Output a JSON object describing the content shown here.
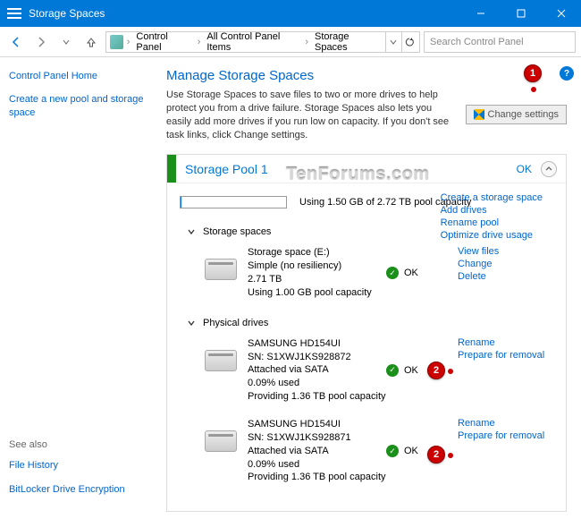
{
  "window": {
    "title": "Storage Spaces"
  },
  "breadcrumb": {
    "items": [
      "Control Panel",
      "All Control Panel Items",
      "Storage Spaces"
    ]
  },
  "search": {
    "placeholder": "Search Control Panel"
  },
  "sidebar": {
    "home": "Control Panel Home",
    "create_pool": "Create a new pool and storage space",
    "see_also_label": "See also",
    "file_history": "File History",
    "bitlocker": "BitLocker Drive Encryption"
  },
  "page": {
    "title": "Manage Storage Spaces",
    "desc": "Use Storage Spaces to save files to two or more drives to help protect you from a drive failure. Storage Spaces also lets you easily add more drives if you run low on capacity. If you don't see task links, click Change settings.",
    "change_settings": "Change settings"
  },
  "pool": {
    "name": "Storage Pool 1",
    "status": "OK",
    "usage_text": "Using 1.50 GB of 2.72 TB pool capacity",
    "progress_pct": 1,
    "links": {
      "create_space": "Create a storage space",
      "add_drives": "Add drives",
      "rename_pool": "Rename pool",
      "optimize": "Optimize drive usage"
    },
    "sections": {
      "spaces_label": "Storage spaces",
      "drives_label": "Physical drives"
    },
    "spaces": [
      {
        "name": "Storage space (E:)",
        "resiliency": "Simple (no resiliency)",
        "size": "2.71 TB",
        "usage": "Using 1.00 GB pool capacity",
        "status": "OK",
        "links": {
          "view": "View files",
          "change": "Change",
          "delete": "Delete"
        }
      }
    ],
    "drives": [
      {
        "model": "SAMSUNG HD154UI",
        "sn": "SN: S1XWJ1KS928872",
        "attached": "Attached via SATA",
        "used": "0.09% used",
        "providing": "Providing 1.36 TB pool capacity",
        "status": "OK",
        "links": {
          "rename": "Rename",
          "prepare": "Prepare for removal"
        }
      },
      {
        "model": "SAMSUNG HD154UI",
        "sn": "SN: S1XWJ1KS928871",
        "attached": "Attached via SATA",
        "used": "0.09% used",
        "providing": "Providing 1.36 TB pool capacity",
        "status": "OK",
        "links": {
          "rename": "Rename",
          "prepare": "Prepare for removal"
        }
      }
    ]
  },
  "annotations": {
    "a1": "1",
    "a2": "2"
  },
  "watermark": "TenForums.com"
}
